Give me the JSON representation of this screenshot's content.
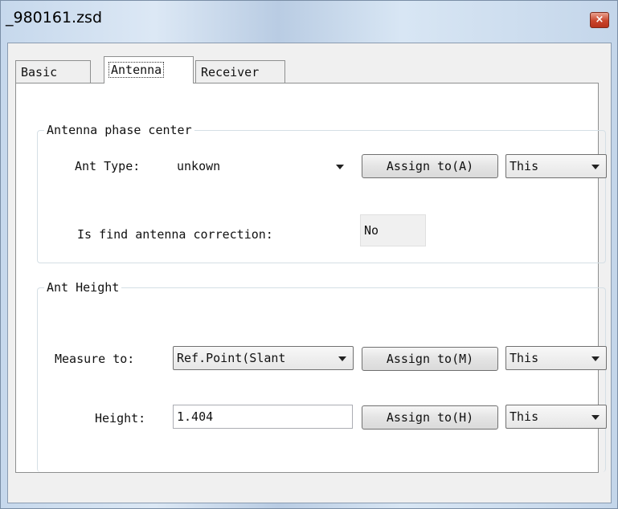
{
  "window": {
    "title": "_980161.zsd",
    "close_symbol": "×"
  },
  "tabs": [
    {
      "label": "Basic",
      "active": false
    },
    {
      "label": "Antenna",
      "active": true
    },
    {
      "label": "Receiver",
      "active": false
    }
  ],
  "phase_center": {
    "legend": "Antenna phase center",
    "ant_type_label": "Ant Type:",
    "ant_type_value": "unkown",
    "assign_label": "Assign to(A)",
    "assign_scope": "This",
    "correction_label": "Is find antenna correction:",
    "correction_value": "No"
  },
  "ant_height": {
    "legend": "Ant Height",
    "measure_label": "Measure to:",
    "measure_value": "Ref.Point(Slant",
    "measure_assign_label": "Assign to(M)",
    "measure_assign_scope": "This",
    "height_label": "Height:",
    "height_value": "1.404",
    "height_assign_label": "Assign to(H)",
    "height_assign_scope": "This"
  },
  "icons": {
    "close": "close-icon",
    "dropdown": "chevron-down-icon"
  }
}
